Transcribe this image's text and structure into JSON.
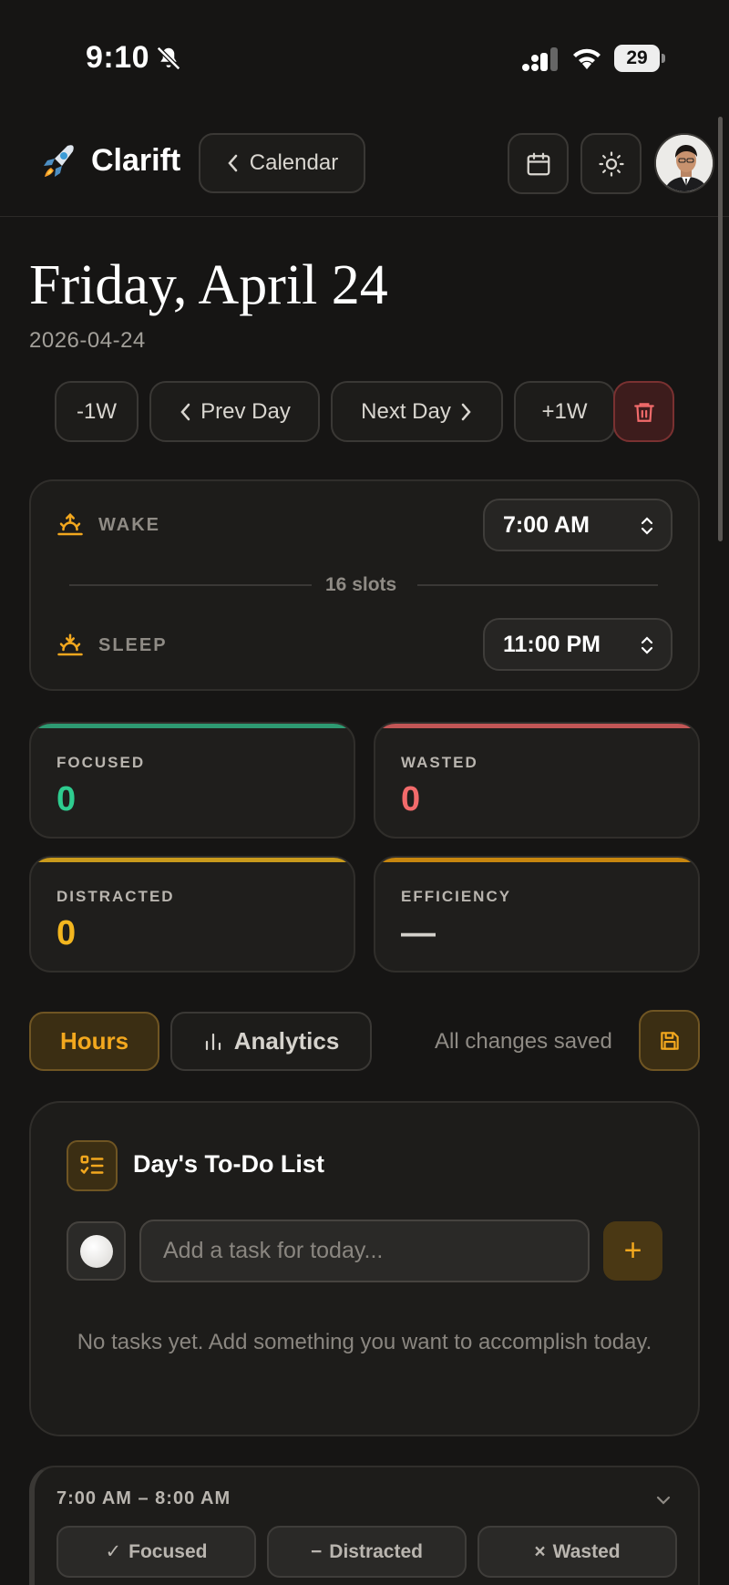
{
  "status_bar": {
    "time": "9:10",
    "battery": "29",
    "battery_level": 0.29
  },
  "header": {
    "brand": "Clarift",
    "back_label": "Calendar"
  },
  "date": {
    "title": "Friday, April 24",
    "iso": "2026-04-24"
  },
  "nav": {
    "minus_week": "-1W",
    "prev_day": "Prev Day",
    "next_day": "Next Day",
    "plus_week": "+1W"
  },
  "schedule": {
    "wake_label": "WAKE",
    "wake_time": "7:00 AM",
    "slots": "16 slots",
    "sleep_label": "SLEEP",
    "sleep_time": "11:00 PM"
  },
  "stats": [
    {
      "label": "FOCUSED",
      "value": "0",
      "color": "#2ecc8f"
    },
    {
      "label": "WASTED",
      "value": "0",
      "color": "#f26b6b"
    },
    {
      "label": "DISTRACTED",
      "value": "0",
      "color": "#f3b61f"
    },
    {
      "label": "EFFICIENCY",
      "value": "—",
      "color": "#d4d1cb"
    }
  ],
  "colors": {
    "accent": "#f3a81e",
    "focused": "#2ecc8f",
    "wasted": "#f26b6b",
    "distracted": "#f3b61f",
    "efficiency": "#e0930f"
  },
  "tabs": {
    "hours": "Hours",
    "analytics": "Analytics",
    "saved_status": "All changes saved"
  },
  "todo": {
    "title": "Day's To-Do List",
    "placeholder": "Add a task for today...",
    "add_label": "+",
    "empty_text": "No tasks yet. Add something you want to accomplish today."
  },
  "slot": {
    "time_range": "7:00 AM – 8:00 AM",
    "focused": "Focused",
    "distracted": "Distracted",
    "wasted": "Wasted"
  }
}
